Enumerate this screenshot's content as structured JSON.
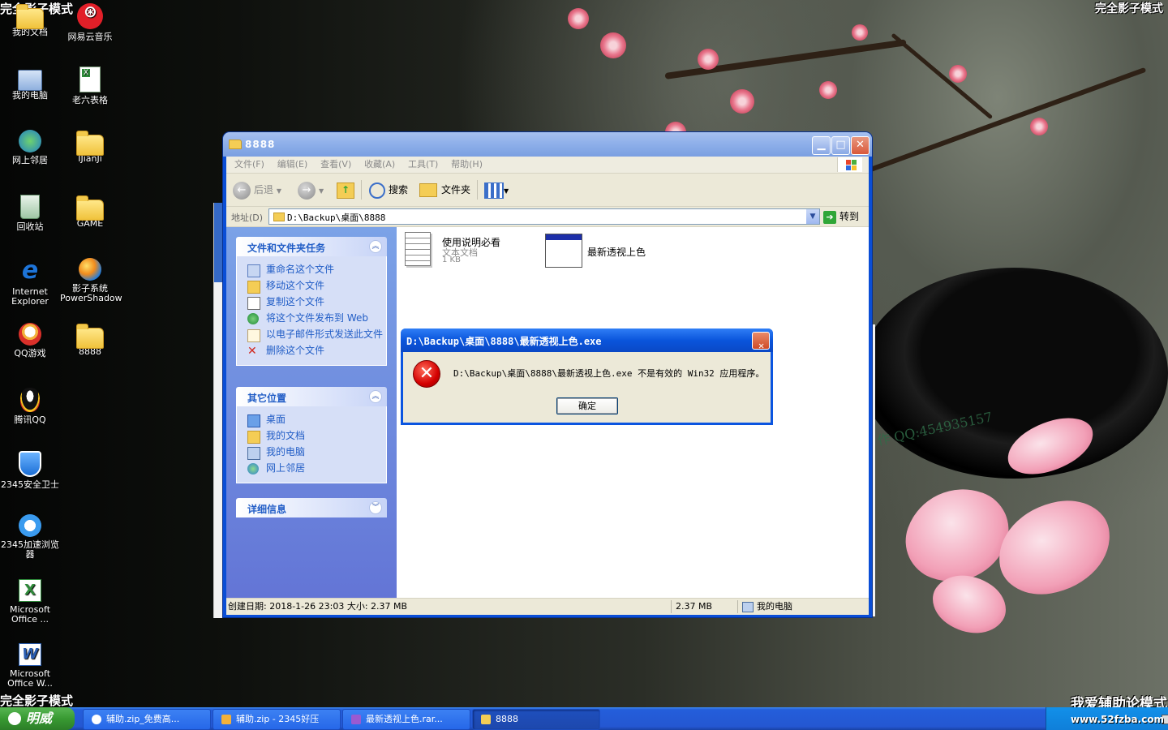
{
  "watermarks": {
    "top_left": "完全影子模式",
    "top_right": "完全影子模式",
    "bottom_left": "完全影子模式",
    "bottom_right": "我爱辅助论模式",
    "site": "www.52fzba.com",
    "qq": "作 QQ:454935157"
  },
  "desktop_icons": [
    {
      "label": "我的文档"
    },
    {
      "label": "网易云音乐"
    },
    {
      "label": "我的电脑"
    },
    {
      "label": "老六表格"
    },
    {
      "label": "网上邻居"
    },
    {
      "label": "IJianJi"
    },
    {
      "label": "回收站"
    },
    {
      "label": "GAME"
    },
    {
      "label": "Internet Explorer"
    },
    {
      "label": "影子系统 PowerShadow"
    },
    {
      "label": "QQ游戏"
    },
    {
      "label": "8888"
    },
    {
      "label": "腾讯QQ"
    },
    {
      "label": "2345安全卫士"
    },
    {
      "label": "2345加速浏览器"
    },
    {
      "label": "Microsoft Office ..."
    },
    {
      "label": "Microsoft Office W..."
    }
  ],
  "explorer": {
    "title": "8888",
    "menu": [
      "文件(F)",
      "编辑(E)",
      "查看(V)",
      "收藏(A)",
      "工具(T)",
      "帮助(H)"
    ],
    "toolbar": {
      "back": "后退",
      "search": "搜索",
      "folders": "文件夹"
    },
    "address": {
      "label": "地址(D)",
      "value": "D:\\Backup\\桌面\\8888",
      "go": "转到"
    },
    "file_tasks": {
      "title": "文件和文件夹任务",
      "items": [
        "重命名这个文件",
        "移动这个文件",
        "复制这个文件",
        "将这个文件发布到 Web",
        "以电子邮件形式发送此文件",
        "删除这个文件"
      ]
    },
    "other_places": {
      "title": "其它位置",
      "items": [
        "桌面",
        "我的文档",
        "我的电脑",
        "网上邻居"
      ]
    },
    "details": {
      "title": "详细信息"
    },
    "files": [
      {
        "name": "使用说明必看",
        "type": "文本文档",
        "size": "1 KB"
      },
      {
        "name": "最新透视上色"
      }
    ],
    "status": {
      "info": "创建日期: 2018-1-26 23:03 大小: 2.37 MB",
      "size": "2.37 MB",
      "location": "我的电脑"
    }
  },
  "dialog": {
    "title": "D:\\Backup\\桌面\\8888\\最新透视上色.exe",
    "message": "D:\\Backup\\桌面\\8888\\最新透视上色.exe 不是有效的 Win32 应用程序。",
    "ok": "确定"
  },
  "taskbar": {
    "start": "明威",
    "buttons": [
      "辅助.zip_免费高...",
      "辅助.zip - 2345好压",
      "最新透视上色.rar...",
      "8888"
    ]
  }
}
